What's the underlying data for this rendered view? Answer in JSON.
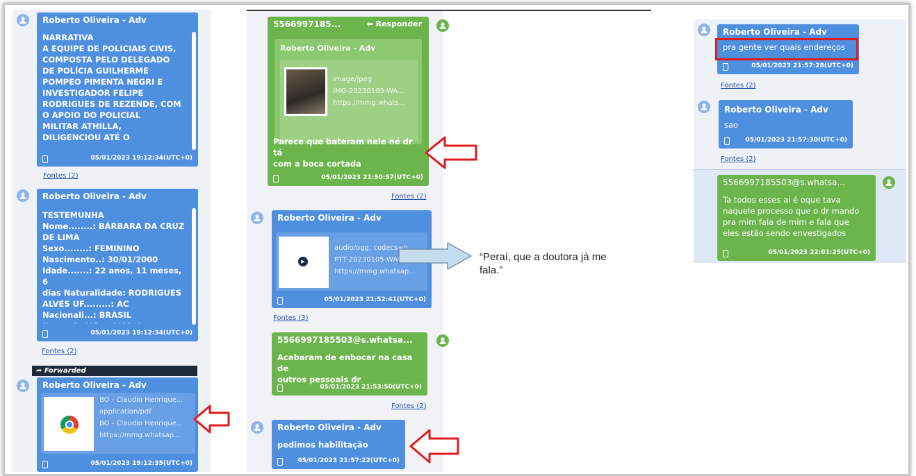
{
  "author": "Roberto Oliveira - Adv",
  "fontes_2": "Fontes (2)",
  "fontes_3": "Fontes (3)",
  "col1": {
    "msg1": {
      "body": "NARRATIVA\nA EQUIPE DE POLICIAIS CIVIS,\nCOMPOSTA PELO DELEGADO\nDE POLÍCIA GUILHERME\nPOMPEO PIMENTA NEGRI E\nINVESTIGADOR FELIPE\nRODRIGUES DE REZENDE, COM\nO APOIO DO POLICIAL\nMILITAR ATHILLA,\nDILIGENCIOU ATÉ O",
      "timestamp": "05/01/2023 19:12:34(UTC+0)"
    },
    "msg2": {
      "body": "TESTEMUNHA\nNome........: BÁRBARA DA CRUZ\nDE LIMA\nSexo........: FEMININO\nNascimento..: 30/01/2000\nIdade.......: 22 anos, 11 meses, 6\ndias Naturalidade: RODRIGUES\nALVES UF.........: AC\nNacionali...: BRASIL\nNome da Mãe.: MARIA",
      "timestamp": "05/01/2023 19:12:34(UTC+0)"
    },
    "forwarded": "Forwarded",
    "msg3": {
      "att1": "BO - Claudio Henrique...",
      "att2": "application/pdf",
      "att3": "BO - Claudio Henrique...",
      "att4": "https://mmg.whatsap...",
      "timestamp": "05/01/2023 19:12:35(UTC+0)"
    }
  },
  "col2": {
    "msg1": {
      "sender": "5566997185...",
      "reply": "Responder",
      "quoted_author": "Roberto Oliveira - Adv",
      "att1": "image/jpeg",
      "att2": "IMG-20230105-WA...",
      "att3": "https://mmg.whats...",
      "body": "Parece que bateram nele né dr tá\ncom a boca cortada",
      "timestamp": "05/01/2023 21:50:57(UTC+0)"
    },
    "msg2": {
      "att1": "audio/ogg; codecs=o...",
      "att2": "PTT-20230105-WA003...",
      "att3": "https://mmg.whatsap...",
      "timestamp": "05/01/2023 21:52:41(UTC+0)"
    },
    "msg3": {
      "sender": "5566997185503@s.whatsa...",
      "body": "Acabaram de enbocar na casa de\noutros pessoais dr",
      "timestamp": "05/01/2023 21:53:50(UTC+0)"
    },
    "msg4": {
      "body": "pedimos habilitação",
      "timestamp": "05/01/2023 21:57:22(UTC+0)"
    }
  },
  "quote": "“Peraí, que a doutora já me\nfala.”",
  "col3": {
    "msg1": {
      "body": "pra gente ver quais endereços",
      "timestamp": "05/01/2023 21:57:28(UTC+0)"
    },
    "msg2": {
      "body": "sao",
      "timestamp": "05/01/2023 21:57:30(UTC+0)"
    },
    "msg3": {
      "sender": "5566997185503@s.whatsa...",
      "body": "Ta todos esses ai é oque tava\nnaquele processo que o dr mando\npra mim fala de mim e fala que\neles estão sendo envestigados",
      "timestamp": "05/01/2023 22:01:25(UTC+0)"
    }
  },
  "colors": {
    "blue": "#4f8fe0",
    "green": "#6bb54c",
    "red": "#e01b1b",
    "link": "#2b55b0"
  }
}
